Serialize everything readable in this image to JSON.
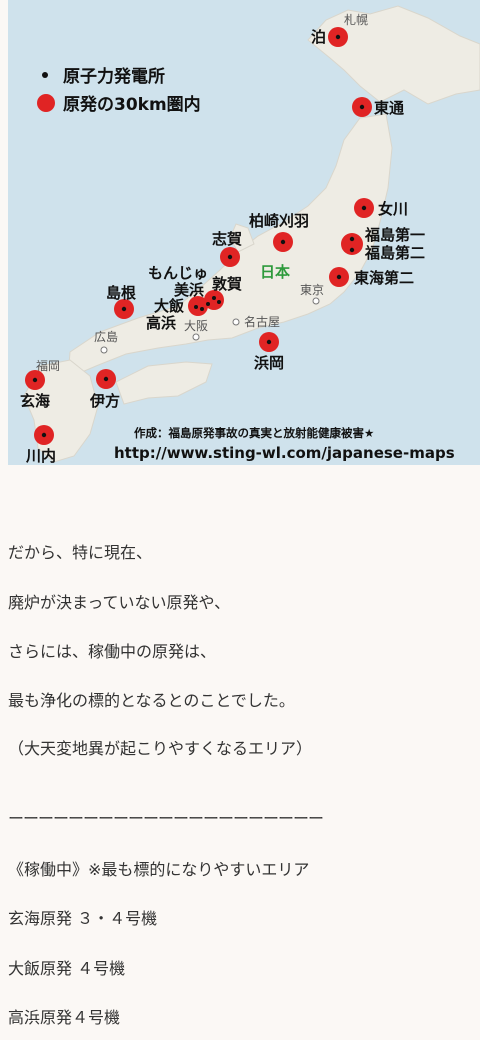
{
  "map": {
    "legend_plant": "原子力発電所",
    "legend_zone": "原発の30km圏内",
    "country_label": "日本",
    "credit": "作成：福島原発事故の真実と放射能健康被害★",
    "url": "http://www.sting-wl.com/japanese-maps",
    "plants": [
      "泊",
      "東通",
      "女川",
      "福島第一",
      "福島第二",
      "東海第二",
      "柏崎刈羽",
      "志賀",
      "もんじゅ",
      "敦賀",
      "美浜",
      "大飯",
      "高浜",
      "島根",
      "浜岡",
      "玄海",
      "伊方",
      "川内"
    ],
    "cities": [
      "札幌",
      "東京",
      "名古屋",
      "大阪",
      "広島",
      "福岡"
    ]
  },
  "article": {
    "lines": [
      "だから、特に現在、",
      "廃炉が決まっていない原発や、",
      "さらには、稼働中の原発は、",
      "最も浄化の標的となるとのことでした。",
      "（大天変地異が起こりやすくなるエリア）",
      "ーーーーーーーーーーーーーーーーーーーーー",
      "《稼働中》※最も標的になりやすいエリア",
      "玄海原発 ３・４号機",
      "大飯原発 ４号機",
      "高浜原発４号機"
    ]
  },
  "colors": {
    "sea": "#cfe2ec",
    "land": "#eeece4",
    "marker": "#e02424",
    "country_label": "#2e9a3c",
    "background": "#fbf8f5"
  }
}
